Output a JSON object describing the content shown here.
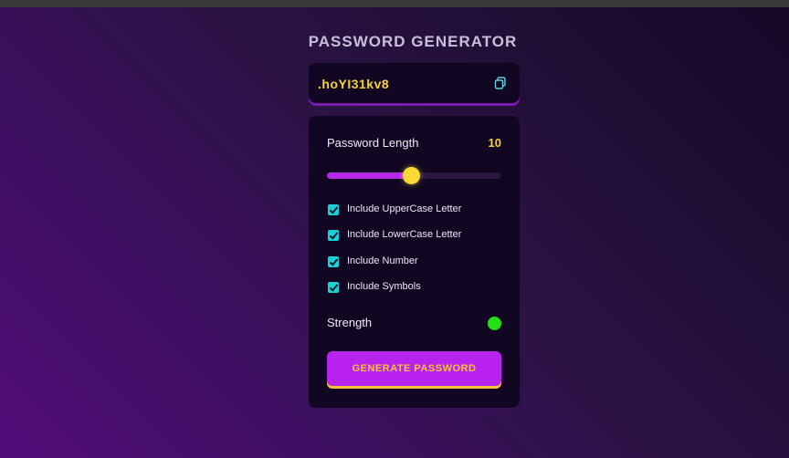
{
  "app": {
    "title": "PASSWORD GENERATOR"
  },
  "display": {
    "password": ".hoYI31kv8",
    "copy_icon": "copy-icon"
  },
  "length": {
    "label": "Password Length",
    "value": "10",
    "slider_fraction": 0.48
  },
  "options": [
    {
      "label": "Include UpperCase Letter",
      "checked": true
    },
    {
      "label": "Include LowerCase Letter",
      "checked": true
    },
    {
      "label": "Include Number",
      "checked": true
    },
    {
      "label": "Include Symbols",
      "checked": true
    }
  ],
  "strength": {
    "label": "Strength",
    "indicator_color": "#22e015"
  },
  "generate": {
    "label": "GENERATE PASSWORD"
  },
  "colors": {
    "accent": "#b923f0",
    "highlight": "#f3d23d",
    "checkbox": "#1ad2d6"
  }
}
